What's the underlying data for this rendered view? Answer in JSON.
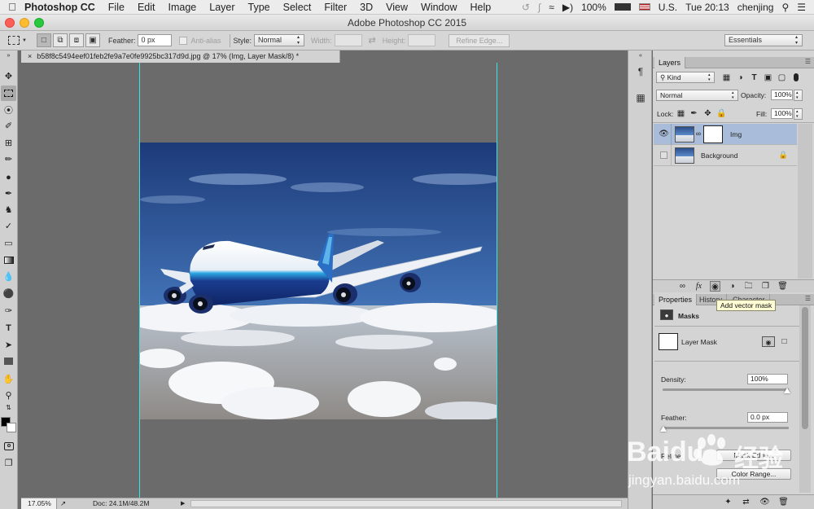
{
  "menubar": {
    "app": "Photoshop CC",
    "items": [
      "File",
      "Edit",
      "Image",
      "Layer",
      "Type",
      "Select",
      "Filter",
      "3D",
      "View",
      "Window",
      "Help"
    ],
    "battery": "100%",
    "input_source": "U.S.",
    "clock": "Tue 20:13",
    "user": "chenjing"
  },
  "window": {
    "title": "Adobe Photoshop CC 2015"
  },
  "options": {
    "feather_label": "Feather:",
    "feather_value": "0 px",
    "antialias_label": "Anti-alias",
    "style_label": "Style:",
    "style_value": "Normal",
    "width_label": "Width:",
    "height_label": "Height:",
    "refine_edge": "Refine Edge...",
    "workspace": "Essentials"
  },
  "document": {
    "tab_title": "b58f8c5494eef01feb2fe9a7e0fe9925bc317d9d.jpg @ 17% (Img, Layer Mask/8) *",
    "close_glyph": "×"
  },
  "status": {
    "zoom": "17.05%",
    "doc_size": "Doc: 24.1M/48.2M"
  },
  "layers_panel": {
    "tab": "Layers",
    "filter_kind": "Kind",
    "blend_mode": "Normal",
    "opacity_label": "Opacity:",
    "opacity_value": "100%",
    "lock_label": "Lock:",
    "fill_label": "Fill:",
    "fill_value": "100%",
    "layers": [
      {
        "name": "Img",
        "visible": true,
        "selected": true
      },
      {
        "name": "Background",
        "visible": false,
        "locked": true
      }
    ]
  },
  "properties_panel": {
    "tabs": [
      "Properties",
      "History",
      "Character"
    ],
    "section": "Masks",
    "mask_name": "Layer Mask",
    "density_label": "Density:",
    "density_value": "100%",
    "feather_label": "Feather:",
    "feather_value": "0.0 px",
    "refine_label": "Mask Edge...",
    "color_range": "Color Range..."
  },
  "tooltip": "Add vector mask",
  "watermark": {
    "brand": "Baidu",
    "brand_cn": "经验",
    "url": "jingyan.baidu.com"
  },
  "colors": {
    "guide": "#39e4ea",
    "selection": "#a9bdda",
    "sky_top": "#1d3a78",
    "sky_bottom": "#5f93cf"
  }
}
